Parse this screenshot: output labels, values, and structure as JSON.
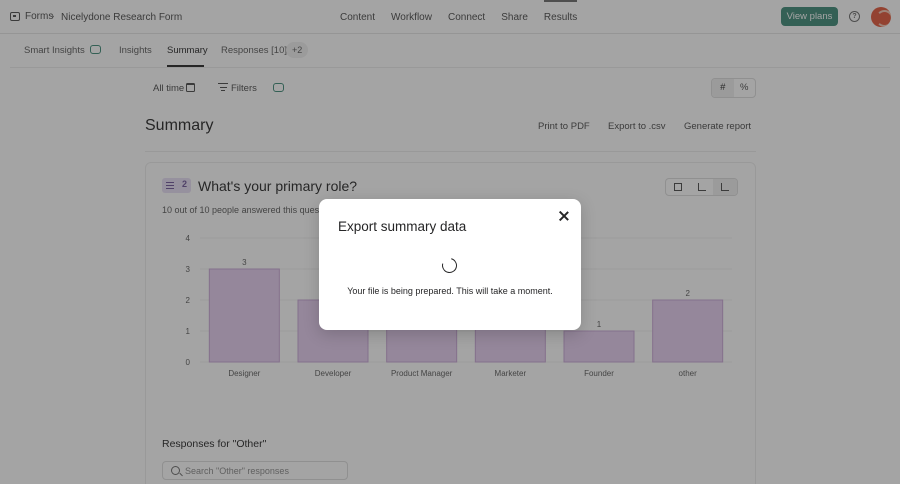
{
  "topbar": {
    "forms_label": "Forms",
    "separator": "›",
    "form_title": "Nicelydone Research Form",
    "nav": [
      "Content",
      "Workflow",
      "Connect",
      "Share",
      "Results"
    ],
    "active_nav": "Results",
    "view_plans_label": "View plans",
    "help_label": "?"
  },
  "subtabs": {
    "smart_insights": "Smart Insights",
    "insights": "Insights",
    "summary": "Summary",
    "responses": "Responses [10]",
    "more_count": "+2",
    "active": "Summary"
  },
  "filters": {
    "time_range": "All time",
    "filters_label": "Filters",
    "display_modes": [
      "#",
      "%"
    ],
    "active_mode": "#"
  },
  "summary": {
    "title": "Summary",
    "print_label": "Print to PDF",
    "export_label": "Export to .csv",
    "report_label": "Generate report"
  },
  "question": {
    "number": "2",
    "title": "What's your primary role?",
    "answered_text": "10 out of 10 people answered this question"
  },
  "chart_data": {
    "type": "bar",
    "categories": [
      "Designer",
      "Developer",
      "Product Manager",
      "Marketer",
      "Founder",
      "other"
    ],
    "values": [
      3,
      2,
      2,
      2,
      1,
      2
    ],
    "ylim": [
      0,
      4
    ],
    "yticks": [
      0,
      1,
      2,
      3,
      4
    ],
    "bar_color": "#e5cdef",
    "bar_border": "#c9a6d6"
  },
  "other_responses": {
    "title": "Responses for \"Other\"",
    "search_placeholder": "Search \"Other\" responses"
  },
  "modal": {
    "title": "Export summary data",
    "message": "Your file is being prepared. This will take a moment."
  },
  "colors": {
    "accent": "#3e8a77",
    "question_badge": "#e7def5"
  }
}
